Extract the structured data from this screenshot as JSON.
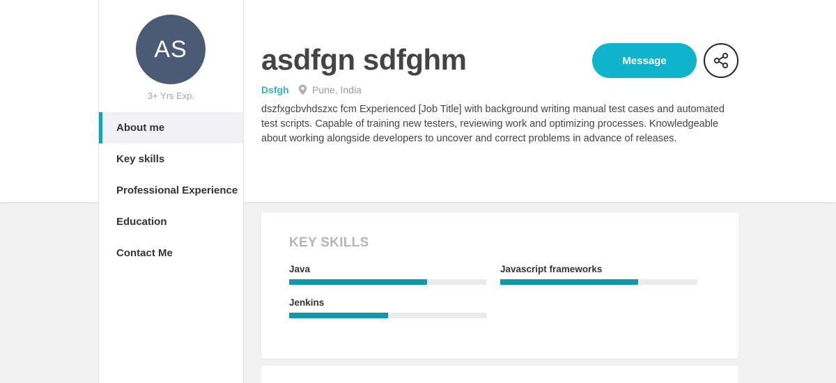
{
  "profile": {
    "initials": "AS",
    "experience": "3+ Yrs Exp.",
    "name": "asdfgn sdfghm",
    "company": "Dsfgh",
    "location": "Pune, India",
    "bio": "dszfxgcbvhdszxc fcm Experienced [Job Title] with background writing manual test cases and automated test scripts. Capable of training new testers, reviewing work and optimizing processes. Knowledgeable about working alongside developers to uncover and correct problems in advance of releases."
  },
  "actions": {
    "message_label": "Message",
    "share_icon": "share-icon"
  },
  "nav": {
    "items": [
      {
        "label": "About me",
        "active": true
      },
      {
        "label": "Key skills",
        "active": false
      },
      {
        "label": "Professional Experience",
        "active": false
      },
      {
        "label": "Education",
        "active": false
      },
      {
        "label": "Contact Me",
        "active": false
      }
    ]
  },
  "skills": {
    "title": "KEY SKILLS",
    "items": [
      {
        "name": "Java",
        "level": 0.7
      },
      {
        "name": "Javascript frameworks",
        "level": 0.7
      },
      {
        "name": "Jenkins",
        "level": 0.5
      }
    ]
  },
  "colors": {
    "accent": "#0fb4cc",
    "avatar_bg": "#4b5a75",
    "skill_fill": "#0e9aaa",
    "company": "#2bb5c8"
  }
}
